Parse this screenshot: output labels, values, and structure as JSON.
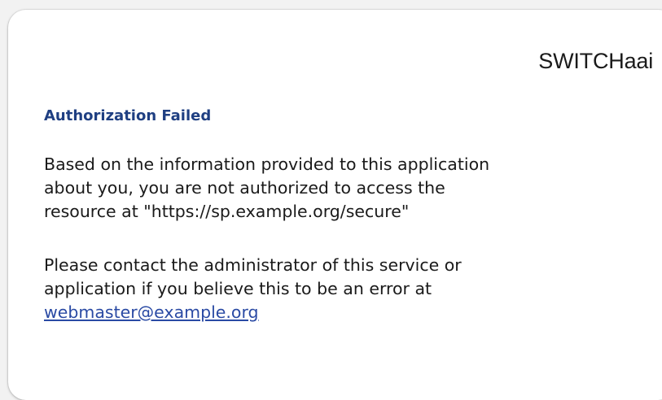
{
  "brand": {
    "name": "SWITCHaai"
  },
  "message": {
    "title": "Authorization Failed",
    "paragraph1_lines": [
      "Based on the information provided to this application",
      "about you, you are not authorized to access the",
      "resource at \"https://sp.example.org/secure\""
    ],
    "paragraph2_lines": [
      "Please contact the administrator of this service or",
      "application if you believe this to be an error at"
    ],
    "contact_email": "webmaster@example.org"
  },
  "colors": {
    "title": "#1f3f82",
    "link": "#2a4aa4",
    "text": "#1a1a1a",
    "card_background": "#ffffff",
    "page_background": "#f2f2f2"
  }
}
